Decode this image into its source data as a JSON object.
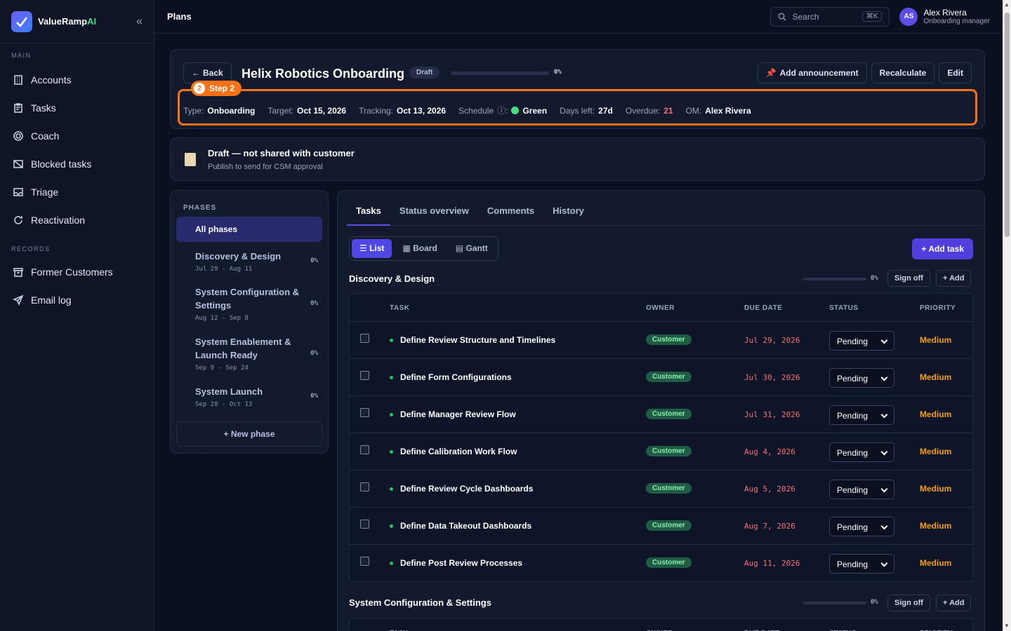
{
  "brand": {
    "name": "ValueRamp",
    "suffix": "AI"
  },
  "sidebar": {
    "main_label": "MAIN",
    "main_items": [
      {
        "label": "Accounts",
        "icon": "building-icon"
      },
      {
        "label": "Tasks",
        "icon": "clipboard-icon"
      },
      {
        "label": "Coach",
        "icon": "target-icon"
      },
      {
        "label": "Blocked tasks",
        "icon": "blocked-icon"
      },
      {
        "label": "Triage",
        "icon": "inbox-icon"
      },
      {
        "label": "Reactivation",
        "icon": "refresh-icon"
      }
    ],
    "records_label": "RECORDS",
    "records_items": [
      {
        "label": "Former Customers",
        "icon": "archive-icon"
      },
      {
        "label": "Email log",
        "icon": "send-icon"
      }
    ]
  },
  "topbar": {
    "title": "Plans",
    "search_placeholder": "Search",
    "search_shortcut": "⌘K",
    "user": {
      "initials": "AS",
      "name": "Alex Rivera",
      "role": "Onboarding manager"
    }
  },
  "plan": {
    "back_label": "Back",
    "title": "Helix Robotics Onboarding",
    "status": "Draft",
    "progress": 0,
    "progress_text": "0%",
    "actions": {
      "announce": "Add announcement",
      "recalculate": "Recalculate",
      "edit": "Edit"
    },
    "step": {
      "num": "2",
      "label": "Step 2"
    },
    "meta": {
      "type_k": "Type:",
      "type_v": "Onboarding",
      "target_k": "Target:",
      "target_v": "Oct 15, 2026",
      "tracking_k": "Tracking:",
      "tracking_v": "Oct 13, 2026",
      "schedule_k": "Schedule",
      "schedule_v": "Green",
      "days_k": "Days left:",
      "days_v": "27d",
      "overdue_k": "Overdue:",
      "overdue_v": "21",
      "om_k": "OM:",
      "om_v": "Alex Rivera"
    },
    "colors": {
      "accent": "#4f46e5",
      "step": "#f97316",
      "schedule": "#4ade80",
      "overdue": "#f87171"
    }
  },
  "banner": {
    "title": "Draft — not shared with customer",
    "subtitle": "Publish to send for CSM approval"
  },
  "phases": {
    "label": "PHASES",
    "all_label": "All phases",
    "items": [
      {
        "name": "Discovery & Design",
        "dates": "Jul 29 - Aug 11",
        "pct": "0%"
      },
      {
        "name": "System Configuration & Settings",
        "dates": "Aug 12 - Sep 8",
        "pct": "0%"
      },
      {
        "name": "System Enablement & Launch Ready",
        "dates": "Sep 9 - Sep 24",
        "pct": "0%"
      },
      {
        "name": "System Launch",
        "dates": "Sep 28 - Oct 13",
        "pct": "0%"
      }
    ],
    "new_label": "+ New phase"
  },
  "tabs": [
    "Tasks",
    "Status overview",
    "Comments",
    "History"
  ],
  "views": [
    "List",
    "Board",
    "Gantt"
  ],
  "add_task_label": "+ Add task",
  "columns": {
    "task": "TASK",
    "owner": "OWNER",
    "due": "DUE DATE",
    "status": "STATUS",
    "priority": "PRIORITY"
  },
  "groups": [
    {
      "title": "Discovery & Design",
      "pct": "0%",
      "signoff": "Sign off",
      "add": "+ Add",
      "rows": [
        {
          "task": "Define Review Structure and Timelines",
          "owner": "Customer",
          "due": "Jul 29, 2026",
          "status": "Pending",
          "priority": "Medium"
        },
        {
          "task": "Define Form Configurations",
          "owner": "Customer",
          "due": "Jul 30, 2026",
          "status": "Pending",
          "priority": "Medium"
        },
        {
          "task": "Define Manager Review Flow",
          "owner": "Customer",
          "due": "Jul 31, 2026",
          "status": "Pending",
          "priority": "Medium"
        },
        {
          "task": "Define Calibration Work Flow",
          "owner": "Customer",
          "due": "Aug 4, 2026",
          "status": "Pending",
          "priority": "Medium"
        },
        {
          "task": "Define Review Cycle Dashboards",
          "owner": "Customer",
          "due": "Aug 5, 2026",
          "status": "Pending",
          "priority": "Medium"
        },
        {
          "task": "Define Data Takeout Dashboards",
          "owner": "Customer",
          "due": "Aug 7, 2026",
          "status": "Pending",
          "priority": "Medium"
        },
        {
          "task": "Define Post Review Processes",
          "owner": "Customer",
          "due": "Aug 11, 2026",
          "status": "Pending",
          "priority": "Medium"
        }
      ]
    },
    {
      "title": "System Configuration & Settings",
      "pct": "0%",
      "signoff": "Sign off",
      "add": "+ Add",
      "rows": []
    }
  ]
}
